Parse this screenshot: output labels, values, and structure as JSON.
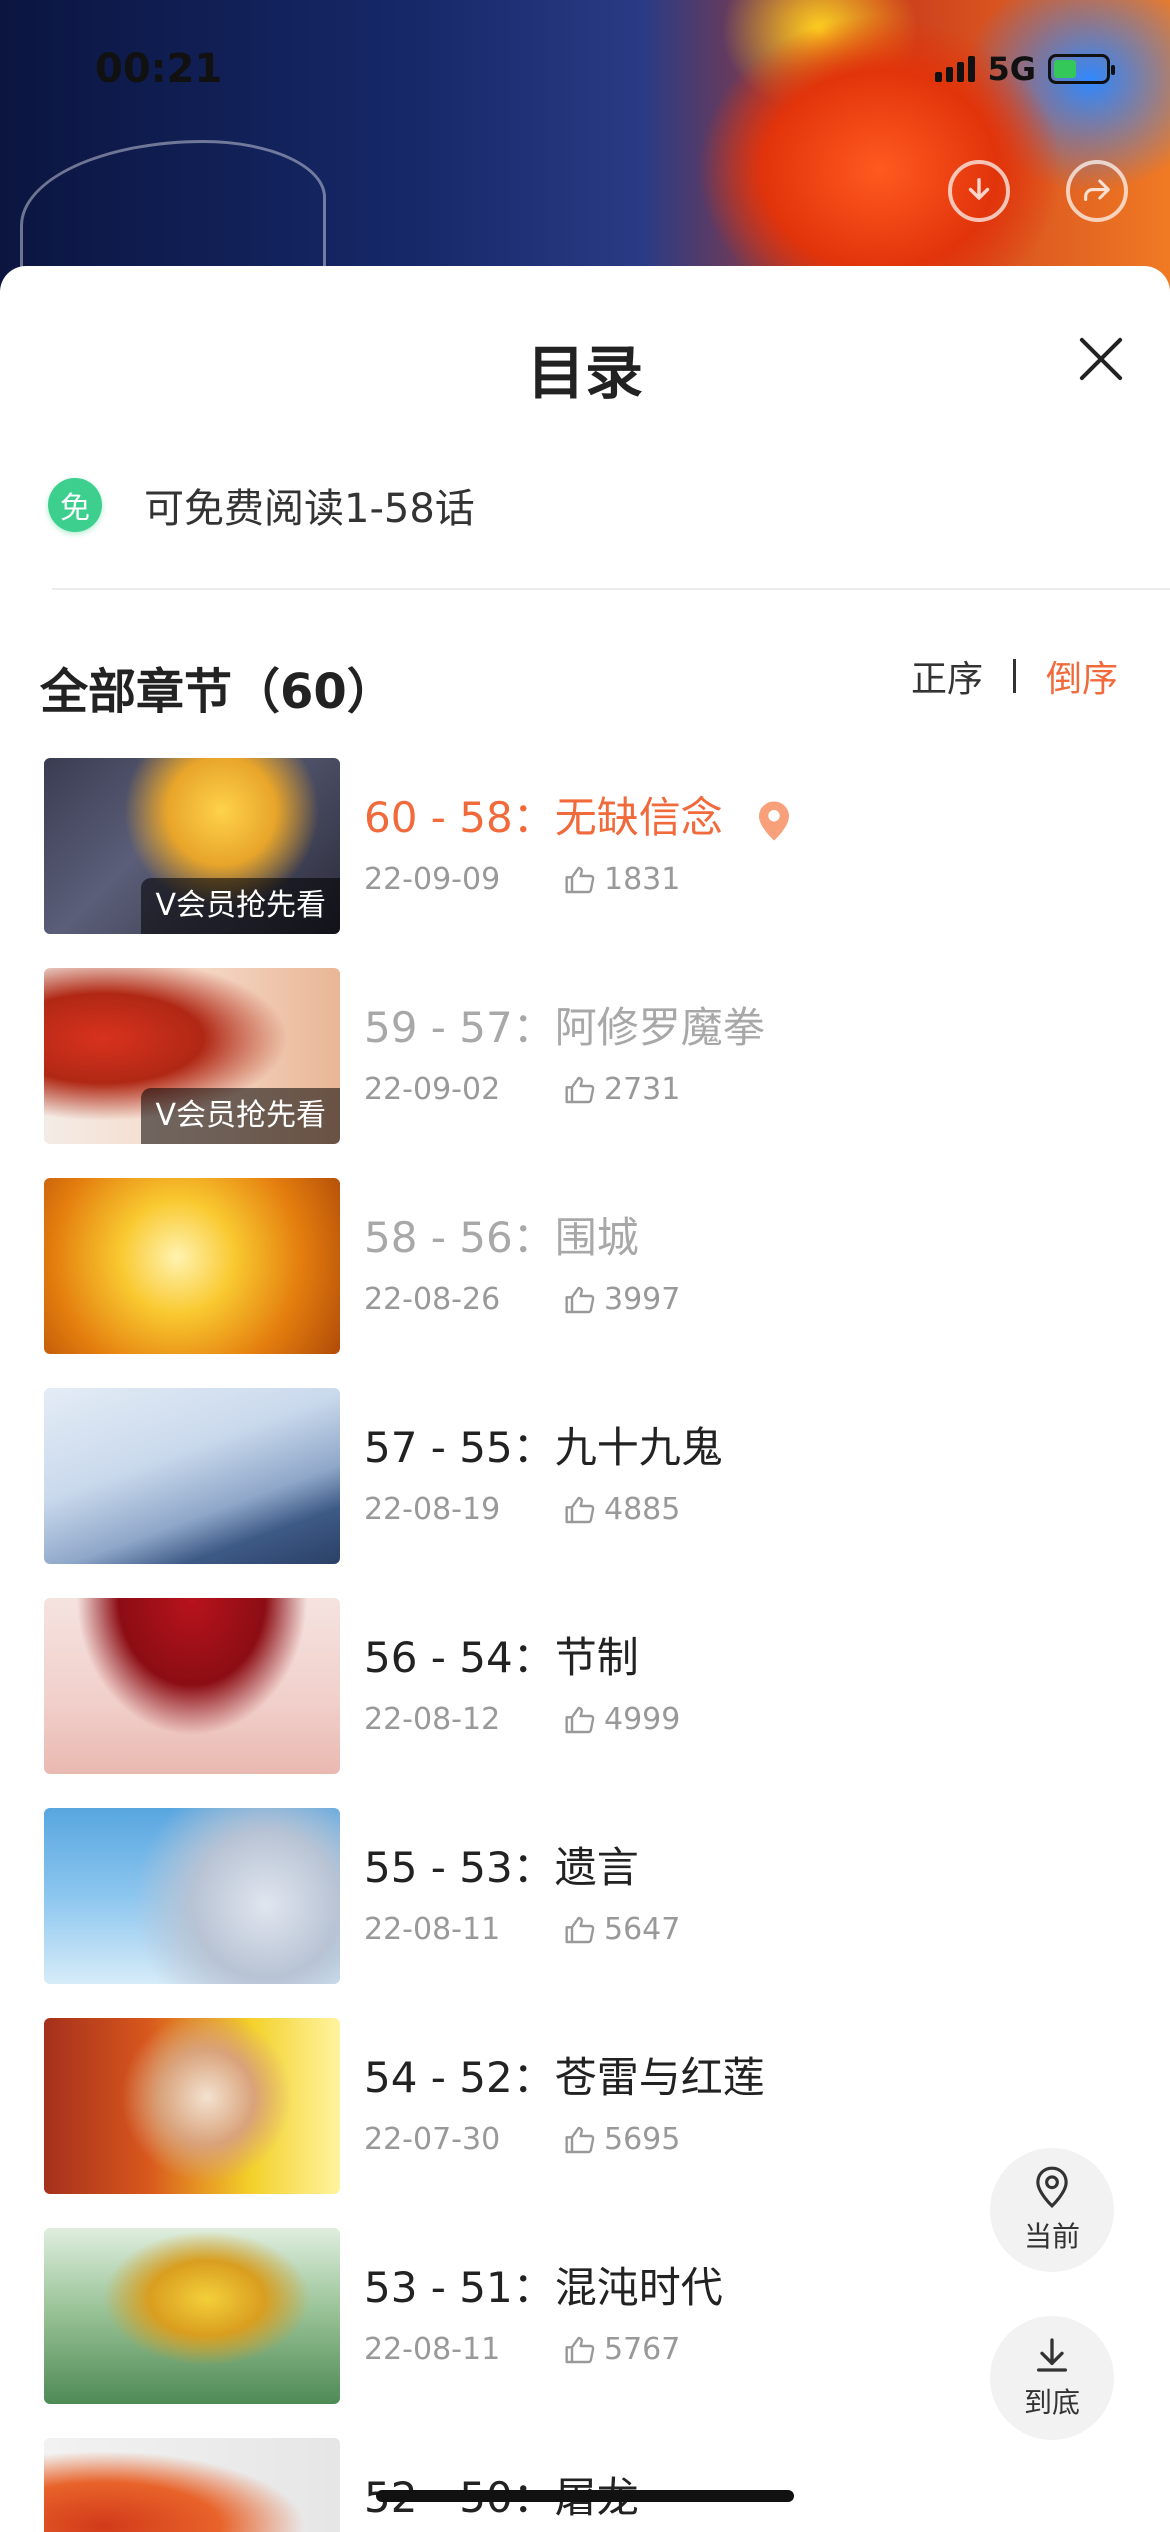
{
  "status_bar": {
    "time": "00:21",
    "network": "5G"
  },
  "sheet": {
    "title": "目录",
    "free_badge": "免",
    "free_text": "可免费阅读1-58话",
    "all_chapters": "全部章节（60）",
    "sort_asc": "正序",
    "sort_desc": "倒序"
  },
  "chapters": [
    {
      "title": "60 - 58：无缺信念",
      "date": "22-09-09",
      "likes": "1831",
      "vip": "V会员抢先看",
      "state": "current"
    },
    {
      "title": "59 - 57：阿修罗魔拳",
      "date": "22-09-02",
      "likes": "2731",
      "vip": "V会员抢先看",
      "state": "read"
    },
    {
      "title": "58 - 56：围城",
      "date": "22-08-26",
      "likes": "3997",
      "state": "read"
    },
    {
      "title": "57 - 55：九十九鬼",
      "date": "22-08-19",
      "likes": "4885",
      "state": "normal"
    },
    {
      "title": "56 - 54：节制",
      "date": "22-08-12",
      "likes": "4999",
      "state": "normal"
    },
    {
      "title": "55 - 53：遗言",
      "date": "22-08-11",
      "likes": "5647",
      "state": "normal"
    },
    {
      "title": "54 - 52：苍雷与红莲",
      "date": "22-07-30",
      "likes": "5695",
      "state": "normal"
    },
    {
      "title": "53 - 51：混沌时代",
      "date": "22-08-11",
      "likes": "5767",
      "state": "normal"
    },
    {
      "title": "52 - 50：屠龙",
      "state": "normal"
    }
  ],
  "float_buttons": {
    "current": "当前",
    "bottom": "到底"
  },
  "icons": {
    "pin": "location-pin-icon",
    "like": "thumb-up-icon",
    "download": "download-icon",
    "share": "share-icon",
    "close": "close-icon",
    "to_bottom": "arrow-to-bottom-icon"
  },
  "colors": {
    "accent": "#f06a3c",
    "free_badge": "#3dcf8e",
    "read_text": "#a8a8a8",
    "meta_text": "#999999"
  }
}
